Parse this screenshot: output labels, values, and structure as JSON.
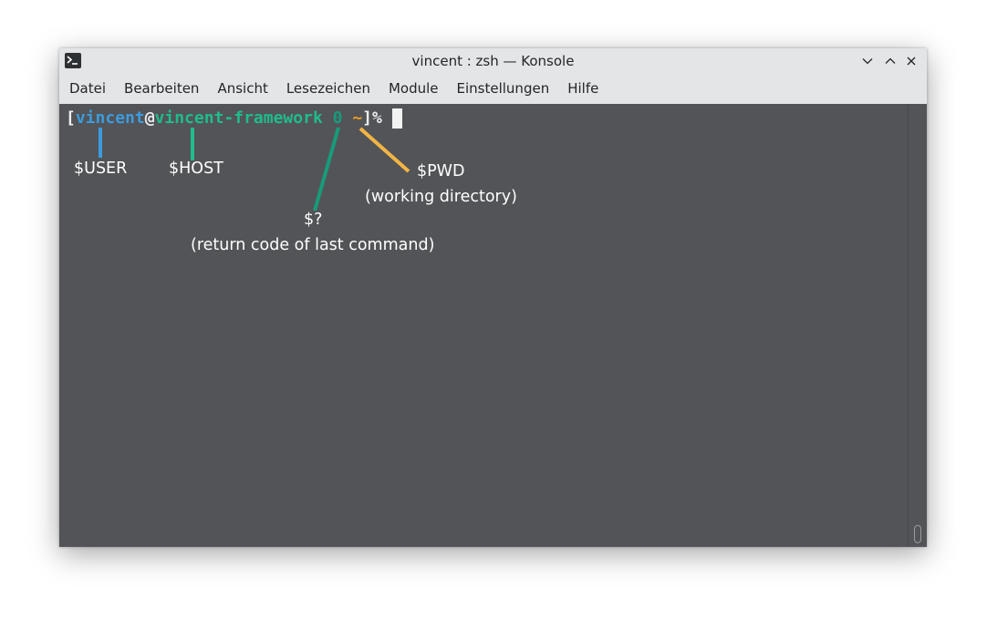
{
  "window": {
    "title": "vincent : zsh — Konsole",
    "app_icon": "terminal-icon",
    "controls": [
      "minimize-icon",
      "maximize-icon",
      "close-icon"
    ]
  },
  "menu": {
    "items": [
      "Datei",
      "Bearbeiten",
      "Ansicht",
      "Lesezeichen",
      "Module",
      "Einstellungen",
      "Hilfe"
    ]
  },
  "prompt": {
    "open_bracket": "[",
    "user": "vincent",
    "at": "@",
    "host": "vincent-framework",
    "return_code": "0",
    "pwd": "~",
    "close": "]%"
  },
  "annotations": {
    "user": "$USER",
    "host": "$HOST",
    "pwd": "$PWD",
    "pwd_desc": "(working directory)",
    "rc": "$?",
    "rc_desc": "(return code of last command)"
  },
  "colors": {
    "user": "#3d9bdd",
    "host": "#1fbc8c",
    "return_code": "#179b7b",
    "pwd": "#f39c1f",
    "terminal_bg": "#535457"
  }
}
